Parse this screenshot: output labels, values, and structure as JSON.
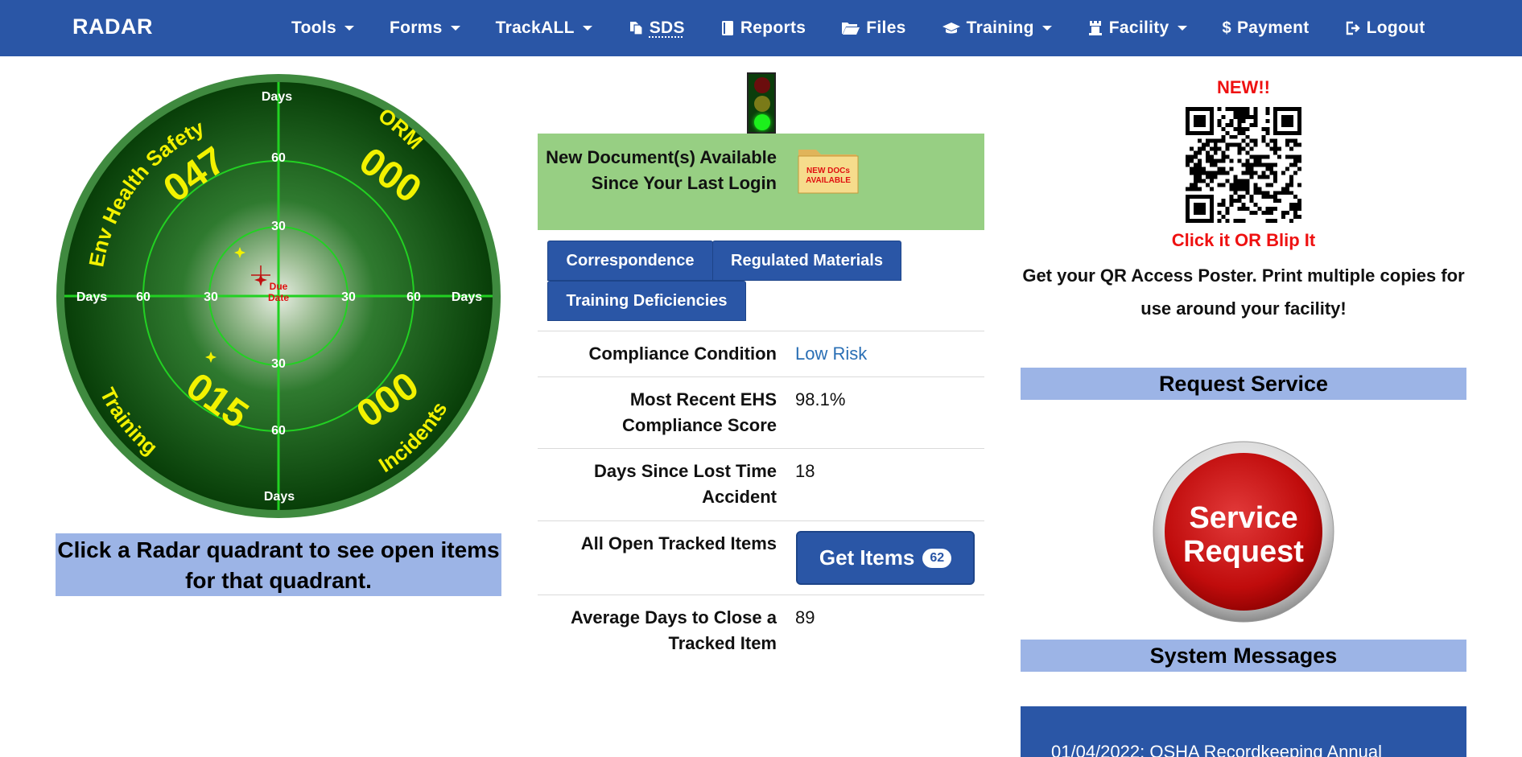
{
  "brand": "RADAR",
  "nav": {
    "tools": "Tools",
    "forms": "Forms",
    "trackall": "TrackALL",
    "sds": "SDS",
    "reports": "Reports",
    "files": "Files",
    "training": "Training",
    "facility": "Facility",
    "payment": "Payment",
    "logout": "Logout"
  },
  "radar": {
    "q_env_label": "Env Health Safety",
    "q_env_count": "047",
    "q_orm_label": "ORM",
    "q_orm_count": "000",
    "q_training_label": "Training",
    "q_training_count": "015",
    "q_incidents_label": "Incidents",
    "q_incidents_count": "000",
    "days": "Days",
    "r60": "60",
    "r30": "30",
    "due_line1": "Due",
    "due_line2": "Date",
    "caption": "Click a Radar quadrant to see open items for that quadrant."
  },
  "newdoc": {
    "text": "New Document(s) Available Since Your Last Login",
    "folder_line1": "NEW DOCs",
    "folder_line2": "AVAILABLE"
  },
  "tabs": {
    "correspondence": "Correspondence",
    "regulated": "Regulated Materials",
    "training_def": "Training Deficiencies"
  },
  "info": {
    "compliance_label": "Compliance Condition",
    "compliance_value": "Low Risk",
    "score_label": "Most Recent EHS Compliance Score",
    "score_value": "98.1%",
    "lost_time_label": "Days Since Lost Time Accident",
    "lost_time_value": "18",
    "open_items_label": "All Open Tracked Items",
    "get_items_label": "Get Items",
    "get_items_count": "62",
    "avg_days_label": "Average Days to Close a Tracked Item",
    "avg_days_value": "89"
  },
  "right": {
    "new_label": "NEW!!",
    "click_blip": "Click it OR Blip It",
    "poster_text": "Get your QR Access Poster. Print multiple copies for use around your facility!",
    "request_service_title": "Request Service",
    "service_btn_line1": "Service",
    "service_btn_line2": "Request",
    "system_messages_title": "System Messages",
    "system_message_1": "01/04/2022: OSHA Recordkeeping Annual"
  },
  "colors": {
    "nav_blue": "#2a56a6",
    "caption_blue": "#9cb4e6",
    "newdoc_green": "#97cf83",
    "alert_red": "#ee1111",
    "link_blue": "#2a6fb5",
    "radar_yellow": "#f2f200"
  }
}
